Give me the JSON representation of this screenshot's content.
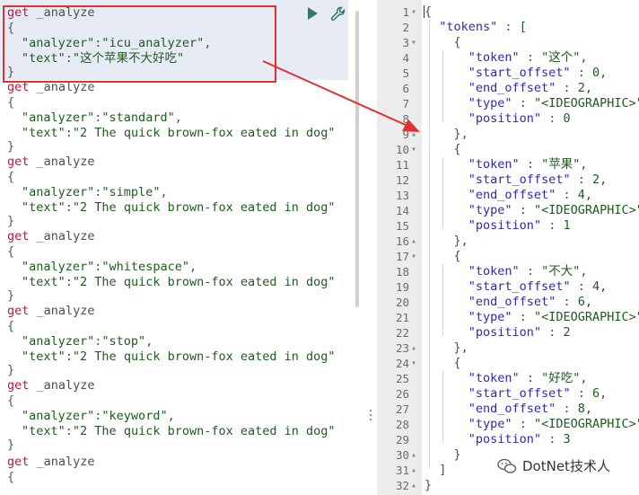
{
  "left_editor": {
    "blocks": [
      {
        "method": "get",
        "endpoint": "_analyze",
        "analyzer_key": "\"analyzer\"",
        "analyzer_val": "\"icu_analyzer\"",
        "text_key": "\"text\"",
        "text_val": "\"这个苹果不大好吃\""
      },
      {
        "method": "get",
        "endpoint": "_analyze",
        "analyzer_key": "\"analyzer\"",
        "analyzer_val": "\"standard\"",
        "text_key": "\"text\"",
        "text_val": "\"2 The quick brown-fox eated in dog\""
      },
      {
        "method": "get",
        "endpoint": "_analyze",
        "analyzer_key": "\"analyzer\"",
        "analyzer_val": "\"simple\"",
        "text_key": "\"text\"",
        "text_val": "\"2 The quick brown-fox eated in dog\""
      },
      {
        "method": "get",
        "endpoint": "_analyze",
        "analyzer_key": "\"analyzer\"",
        "analyzer_val": "\"whitespace\"",
        "text_key": "\"text\"",
        "text_val": "\"2 The quick brown-fox eated in dog\""
      },
      {
        "method": "get",
        "endpoint": "_analyze",
        "analyzer_key": "\"analyzer\"",
        "analyzer_val": "\"stop\"",
        "text_key": "\"text\"",
        "text_val": "\"2 The quick brown-fox eated in dog\""
      },
      {
        "method": "get",
        "endpoint": "_analyze",
        "analyzer_key": "\"analyzer\"",
        "analyzer_val": "\"keyword\"",
        "text_key": "\"text\"",
        "text_val": "\"2 The quick brown-fox eated in dog\""
      }
    ],
    "last_method": "get",
    "last_endpoint": "_analyze",
    "open_brace": "{",
    "close_brace": "}",
    "comma": ",",
    "colon": ":"
  },
  "right_output": {
    "lines": [
      {
        "n": "1",
        "fold": "▾",
        "text": "{"
      },
      {
        "n": "2",
        "fold": "",
        "text": "  \"tokens\" : ["
      },
      {
        "n": "3",
        "fold": "▾",
        "text": "    {"
      },
      {
        "n": "4",
        "fold": "",
        "text": "      \"token\" : \"这个\","
      },
      {
        "n": "5",
        "fold": "",
        "text": "      \"start_offset\" : 0,"
      },
      {
        "n": "6",
        "fold": "",
        "text": "      \"end_offset\" : 2,"
      },
      {
        "n": "7",
        "fold": "",
        "text": "      \"type\" : \"<IDEOGRAPHIC>\","
      },
      {
        "n": "8",
        "fold": "",
        "text": "      \"position\" : 0"
      },
      {
        "n": "9",
        "fold": "▴",
        "text": "    },"
      },
      {
        "n": "10",
        "fold": "▾",
        "text": "    {"
      },
      {
        "n": "11",
        "fold": "",
        "text": "      \"token\" : \"苹果\","
      },
      {
        "n": "12",
        "fold": "",
        "text": "      \"start_offset\" : 2,"
      },
      {
        "n": "13",
        "fold": "",
        "text": "      \"end_offset\" : 4,"
      },
      {
        "n": "14",
        "fold": "",
        "text": "      \"type\" : \"<IDEOGRAPHIC>\","
      },
      {
        "n": "15",
        "fold": "",
        "text": "      \"position\" : 1"
      },
      {
        "n": "16",
        "fold": "▴",
        "text": "    },"
      },
      {
        "n": "17",
        "fold": "▾",
        "text": "    {"
      },
      {
        "n": "18",
        "fold": "",
        "text": "      \"token\" : \"不大\","
      },
      {
        "n": "19",
        "fold": "",
        "text": "      \"start_offset\" : 4,"
      },
      {
        "n": "20",
        "fold": "",
        "text": "      \"end_offset\" : 6,"
      },
      {
        "n": "21",
        "fold": "",
        "text": "      \"type\" : \"<IDEOGRAPHIC>\","
      },
      {
        "n": "22",
        "fold": "",
        "text": "      \"position\" : 2"
      },
      {
        "n": "23",
        "fold": "▴",
        "text": "    },"
      },
      {
        "n": "24",
        "fold": "▾",
        "text": "    {"
      },
      {
        "n": "25",
        "fold": "",
        "text": "      \"token\" : \"好吃\","
      },
      {
        "n": "26",
        "fold": "",
        "text": "      \"start_offset\" : 6,"
      },
      {
        "n": "27",
        "fold": "",
        "text": "      \"end_offset\" : 8,"
      },
      {
        "n": "28",
        "fold": "",
        "text": "      \"type\" : \"<IDEOGRAPHIC>\","
      },
      {
        "n": "29",
        "fold": "",
        "text": "      \"position\" : 3"
      },
      {
        "n": "30",
        "fold": "▴",
        "text": "    }"
      },
      {
        "n": "31",
        "fold": "▴",
        "text": "  ]"
      },
      {
        "n": "32",
        "fold": "▴",
        "text": "}"
      }
    ]
  },
  "toolbar": {
    "run_icon": "play-icon",
    "settings_icon": "wrench-icon"
  },
  "watermark": {
    "icon": "wechat-icon",
    "text": "DotNet技术人"
  },
  "colors": {
    "method": "#c1153b",
    "string": "#1c5c1c",
    "key": "#2b2bb0",
    "highlight": "#e7ebf5",
    "annotation": "#e03030"
  }
}
